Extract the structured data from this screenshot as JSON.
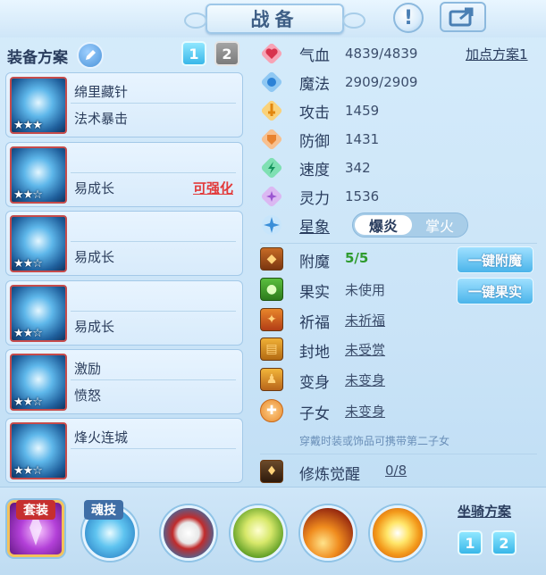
{
  "header": {
    "title": "战备",
    "hint_label": "!"
  },
  "left": {
    "scheme_title": "装备方案",
    "scheme_tabs": [
      "1",
      "2"
    ],
    "cards": [
      {
        "line1": "绵里藏针",
        "line2": "法术暴击",
        "stars": "★★★",
        "enhance": ""
      },
      {
        "line1": "",
        "line2": "易成长",
        "stars": "★★☆",
        "enhance": "可强化"
      },
      {
        "line1": "",
        "line2": "易成长",
        "stars": "★★☆",
        "enhance": ""
      },
      {
        "line1": "",
        "line2": "易成长",
        "stars": "★★☆",
        "enhance": ""
      },
      {
        "line1": "激励",
        "line2": "愤怒",
        "stars": "★★☆",
        "enhance": ""
      },
      {
        "line1": "烽火连城",
        "line2": "",
        "stars": "★★☆",
        "enhance": ""
      }
    ]
  },
  "stats": {
    "plan_link": "加点方案1",
    "rows": [
      {
        "label": "气血",
        "value": "4839/4839",
        "color": "#e9536e"
      },
      {
        "label": "魔法",
        "value": "2909/2909",
        "color": "#3b93e0"
      },
      {
        "label": "攻击",
        "value": "1459",
        "color": "#f2a51f"
      },
      {
        "label": "防御",
        "value": "1431",
        "color": "#f08f3c"
      },
      {
        "label": "速度",
        "value": "342",
        "color": "#27b97a"
      },
      {
        "label": "灵力",
        "value": "1536",
        "color": "#b57be0"
      }
    ],
    "star_label": "星象",
    "star_options": [
      "爆炎",
      "掌火"
    ]
  },
  "extras": {
    "rows": [
      {
        "label": "附魔",
        "value": "5/5"
      },
      {
        "label": "果实",
        "value": "未使用"
      },
      {
        "label": "祈福",
        "value": "未祈福"
      },
      {
        "label": "封地",
        "value": "未受赏"
      },
      {
        "label": "变身",
        "value": "未变身"
      },
      {
        "label": "子女",
        "value": "未变身"
      }
    ],
    "button_enchant": "一键附魔",
    "button_fruit": "一键果实",
    "note": "穿戴时装或饰品可携带第二子女",
    "awaken_label": "修炼觉醒",
    "awaken_value": "0/8"
  },
  "bottom": {
    "set_label": "套装",
    "soul_label": "魂技",
    "mount_title": "坐骑方案",
    "mount_tabs": [
      "1",
      "2"
    ]
  }
}
